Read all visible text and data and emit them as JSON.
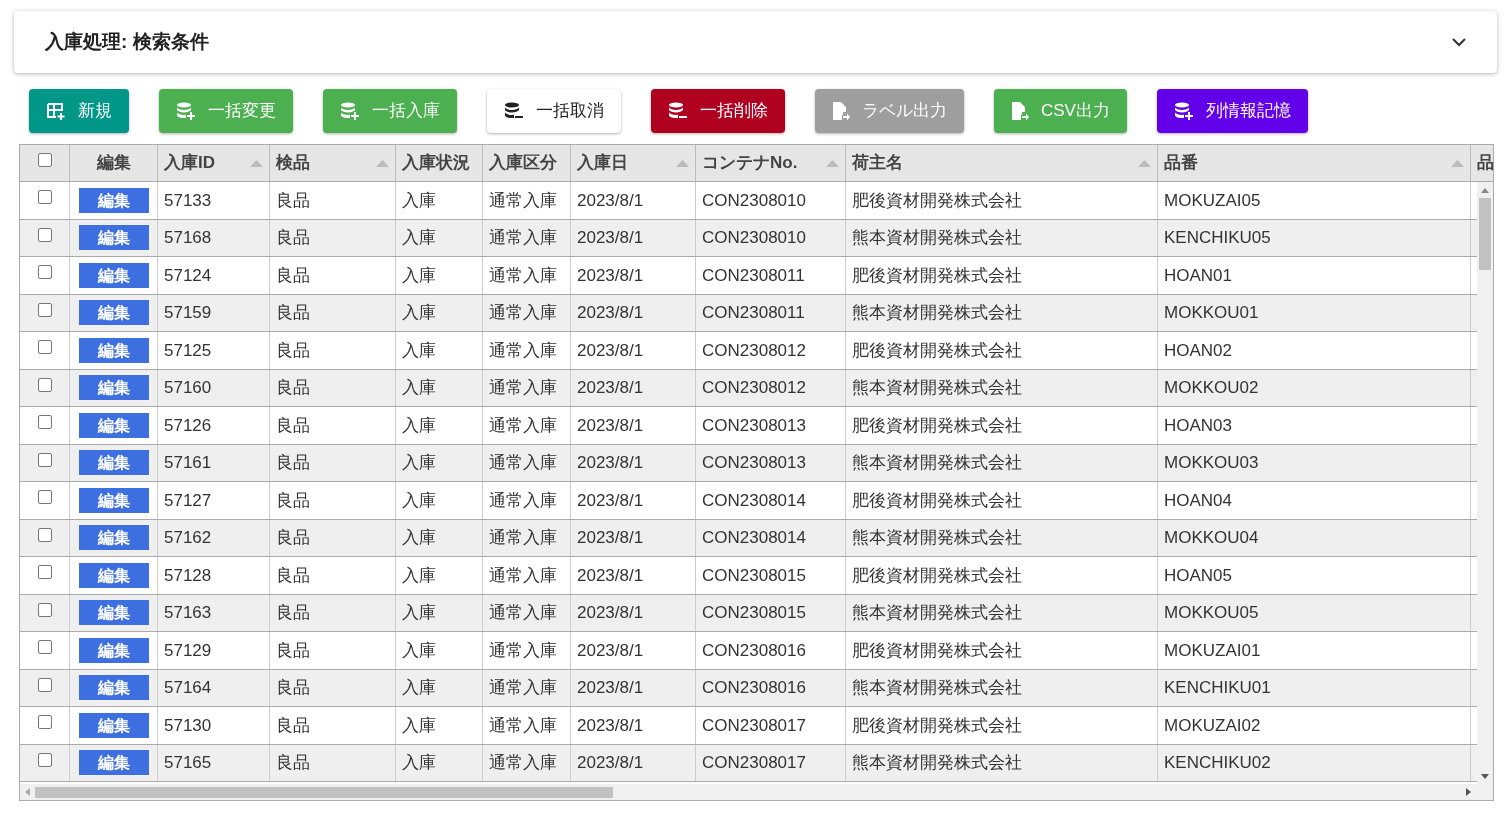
{
  "search_panel": {
    "title": "入庫処理: 検索条件",
    "expanded": false
  },
  "buttons": [
    {
      "label": "新規",
      "kind": "create",
      "color": "#009688"
    },
    {
      "label": "一括変更",
      "kind": "add",
      "color": "#4caf50"
    },
    {
      "label": "一括入庫",
      "kind": "add",
      "color": "#4caf50"
    },
    {
      "label": "一括取消",
      "kind": "remove",
      "color": "#ffffff"
    },
    {
      "label": "一括削除",
      "kind": "remove",
      "color": "#b00020"
    },
    {
      "label": "ラベル出力",
      "kind": "export",
      "color": "#9e9e9e"
    },
    {
      "label": "CSV出力",
      "kind": "export",
      "color": "#4caf50"
    },
    {
      "label": "列情報記憶",
      "kind": "add",
      "color": "#6200ea"
    }
  ],
  "table": {
    "select_all_checked": false,
    "columns": [
      {
        "label": "編集",
        "sortable": false,
        "kind": "button"
      },
      {
        "label": "入庫ID",
        "sortable": true
      },
      {
        "label": "検品",
        "sortable": true
      },
      {
        "label": "入庫状況",
        "sortable": false
      },
      {
        "label": "入庫区分",
        "sortable": false
      },
      {
        "label": "入庫日",
        "sortable": true
      },
      {
        "label": "コンテナNo.",
        "sortable": true
      },
      {
        "label": "荷主名",
        "sortable": true
      },
      {
        "label": "品番",
        "sortable": true
      },
      {
        "label": "品"
      }
    ],
    "rows": [
      {
        "checked": false,
        "cells": [
          "編集",
          "57133",
          "良品",
          "入庫",
          "通常入庫",
          "2023/8/1",
          "CON2308010",
          "肥後資材開発株式会社",
          "MOKUZAI05"
        ]
      },
      {
        "checked": false,
        "cells": [
          "編集",
          "57168",
          "良品",
          "入庫",
          "通常入庫",
          "2023/8/1",
          "CON2308010",
          "熊本資材開発株式会社",
          "KENCHIKU05"
        ]
      },
      {
        "checked": false,
        "cells": [
          "編集",
          "57124",
          "良品",
          "入庫",
          "通常入庫",
          "2023/8/1",
          "CON2308011",
          "肥後資材開発株式会社",
          "HOAN01"
        ]
      },
      {
        "checked": false,
        "cells": [
          "編集",
          "57159",
          "良品",
          "入庫",
          "通常入庫",
          "2023/8/1",
          "CON2308011",
          "熊本資材開発株式会社",
          "MOKKOU01"
        ]
      },
      {
        "checked": false,
        "cells": [
          "編集",
          "57125",
          "良品",
          "入庫",
          "通常入庫",
          "2023/8/1",
          "CON2308012",
          "肥後資材開発株式会社",
          "HOAN02"
        ]
      },
      {
        "checked": false,
        "cells": [
          "編集",
          "57160",
          "良品",
          "入庫",
          "通常入庫",
          "2023/8/1",
          "CON2308012",
          "熊本資材開発株式会社",
          "MOKKOU02"
        ]
      },
      {
        "checked": false,
        "cells": [
          "編集",
          "57126",
          "良品",
          "入庫",
          "通常入庫",
          "2023/8/1",
          "CON2308013",
          "肥後資材開発株式会社",
          "HOAN03"
        ]
      },
      {
        "checked": false,
        "cells": [
          "編集",
          "57161",
          "良品",
          "入庫",
          "通常入庫",
          "2023/8/1",
          "CON2308013",
          "熊本資材開発株式会社",
          "MOKKOU03"
        ]
      },
      {
        "checked": false,
        "cells": [
          "編集",
          "57127",
          "良品",
          "入庫",
          "通常入庫",
          "2023/8/1",
          "CON2308014",
          "肥後資材開発株式会社",
          "HOAN04"
        ]
      },
      {
        "checked": false,
        "cells": [
          "編集",
          "57162",
          "良品",
          "入庫",
          "通常入庫",
          "2023/8/1",
          "CON2308014",
          "熊本資材開発株式会社",
          "MOKKOU04"
        ]
      },
      {
        "checked": false,
        "cells": [
          "編集",
          "57128",
          "良品",
          "入庫",
          "通常入庫",
          "2023/8/1",
          "CON2308015",
          "肥後資材開発株式会社",
          "HOAN05"
        ]
      },
      {
        "checked": false,
        "cells": [
          "編集",
          "57163",
          "良品",
          "入庫",
          "通常入庫",
          "2023/8/1",
          "CON2308015",
          "熊本資材開発株式会社",
          "MOKKOU05"
        ]
      },
      {
        "checked": false,
        "cells": [
          "編集",
          "57129",
          "良品",
          "入庫",
          "通常入庫",
          "2023/8/1",
          "CON2308016",
          "肥後資材開発株式会社",
          "MOKUZAI01"
        ]
      },
      {
        "checked": false,
        "cells": [
          "編集",
          "57164",
          "良品",
          "入庫",
          "通常入庫",
          "2023/8/1",
          "CON2308016",
          "熊本資材開発株式会社",
          "KENCHIKU01"
        ]
      },
      {
        "checked": false,
        "cells": [
          "編集",
          "57130",
          "良品",
          "入庫",
          "通常入庫",
          "2023/8/1",
          "CON2308017",
          "肥後資材開発株式会社",
          "MOKUZAI02"
        ]
      },
      {
        "checked": false,
        "cells": [
          "編集",
          "57165",
          "良品",
          "入庫",
          "通常入庫",
          "2023/8/1",
          "CON2308017",
          "熊本資材開発株式会社",
          "KENCHIKU02"
        ]
      }
    ]
  }
}
